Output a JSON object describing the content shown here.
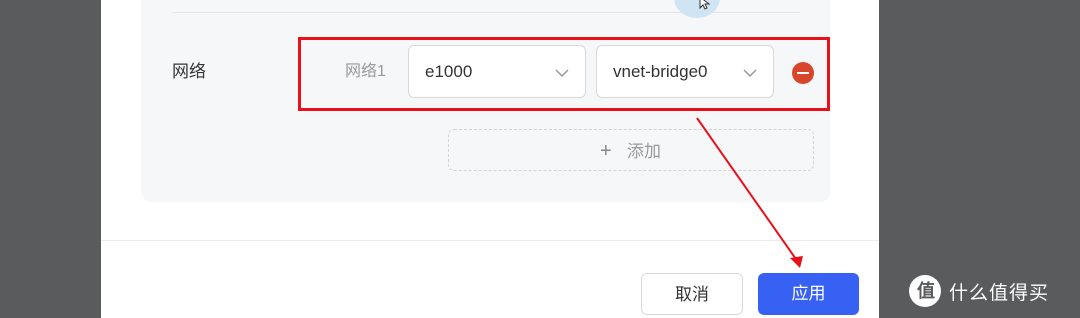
{
  "network": {
    "row_label": "网络",
    "item_label": "网络1",
    "adapter_select_value": "e1000",
    "bridge_select_value": "vnet-bridge0",
    "add_label": "添加"
  },
  "footer": {
    "cancel_label": "取消",
    "apply_label": "应用"
  },
  "watermark": {
    "text": "什么值得买",
    "logo_glyph": "值"
  },
  "colors": {
    "highlight": "#e8111a",
    "primary": "#3761f3",
    "danger": "#d9452b"
  }
}
